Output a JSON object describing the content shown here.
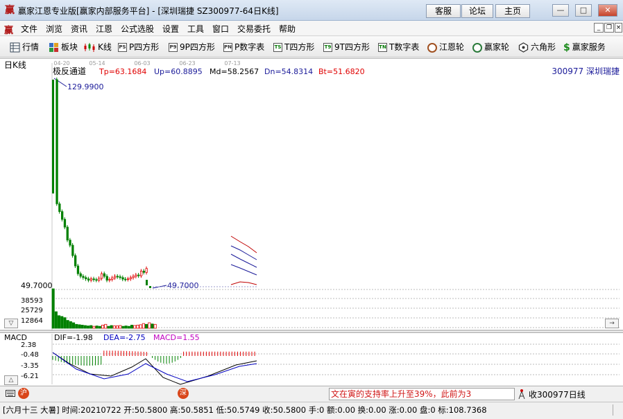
{
  "window": {
    "title": "赢家江恩专业版[赢家内部服务平台] - [深圳瑞捷  SZ300977-64日K线]",
    "links": [
      "客服",
      "论坛",
      "主页"
    ],
    "controls": [
      "—",
      "□",
      "✕"
    ]
  },
  "menu": {
    "items": [
      "文件",
      "浏览",
      "资讯",
      "江恩",
      "公式选股",
      "设置",
      "工具",
      "窗口",
      "交易委托",
      "帮助"
    ],
    "mdi_controls": [
      "_",
      "❐",
      "×"
    ]
  },
  "toolbar": {
    "items": [
      {
        "label": "行情",
        "icon": "grid-icon"
      },
      {
        "label": "板块",
        "icon": "blocks-icon"
      },
      {
        "label": "K线",
        "icon": "candlestick-icon"
      },
      {
        "label": "P四方形",
        "icon": "p-square-icon",
        "glyph": "PS"
      },
      {
        "label": "9P四方形",
        "icon": "9p-square-icon",
        "glyph": "P9"
      },
      {
        "label": "P数字表",
        "icon": "p-number-icon",
        "glyph": "PN"
      },
      {
        "label": "T四方形",
        "icon": "t-square-icon",
        "glyph": "TS"
      },
      {
        "label": "9T四方形",
        "icon": "9t-square-icon",
        "glyph": "T9"
      },
      {
        "label": "T数字表",
        "icon": "t-number-icon",
        "glyph": "TN"
      },
      {
        "label": "江恩轮",
        "icon": "gann-wheel-icon"
      },
      {
        "label": "赢家轮",
        "icon": "winner-wheel-icon"
      },
      {
        "label": "六角形",
        "icon": "hexagon-icon"
      },
      {
        "label": "赢家服务",
        "icon": "dollar-icon"
      }
    ]
  },
  "chart": {
    "period_label": "日K线",
    "indicator_name": "极反通道",
    "tp": "Tp=63.1684",
    "up": "Up=60.8895",
    "md": "Md=58.2567",
    "dn": "Dn=54.8314",
    "bt": "Bt=51.6820",
    "stock": "300977  深圳瑞捷",
    "date_ticks": [
      "04-20",
      "05-14",
      "06-03",
      "06-23",
      "07-13"
    ],
    "high_label": "129.9900",
    "low_label": "49.7000",
    "left_price": "49.7000",
    "volume_ticks": [
      "38593",
      "25729",
      "12864"
    ],
    "macd_title": "MACD",
    "dif": "DIF=-1.98",
    "dea": "DEA=-2.75",
    "macd": "MACD=1.55",
    "macd_ticks": [
      "2.38",
      "-0.48",
      "-3.35",
      "-6.21"
    ],
    "colors": {
      "up": "#e00000",
      "down": "#008000",
      "dif": "#000000",
      "dea": "#0000c0",
      "macd_text": "#c000c0"
    }
  },
  "chart_data": {
    "type": "candlestick",
    "title": "300977 深圳瑞捷 日K线",
    "x_ticks": [
      "04-20",
      "05-14",
      "06-03",
      "06-23",
      "07-13"
    ],
    "ylim": [
      49.7,
      129.99
    ],
    "series": [
      {
        "name": "close",
        "values": [
          129.99,
          82,
          79,
          76,
          73,
          68,
          66,
          62,
          58,
          55,
          54,
          53.5,
          53,
          52.5,
          53,
          52.7,
          52.5,
          53.2,
          55,
          54,
          52.5,
          52.8,
          53.4,
          54,
          53.8,
          53.5,
          52.9,
          52.8,
          53,
          53.5,
          54,
          54.5,
          54.2,
          56,
          55.5,
          57
        ]
      }
    ],
    "volume_ticks": [
      38593,
      25729,
      12864
    ],
    "macd": {
      "dif": -1.98,
      "dea": -2.75,
      "macd": 1.55,
      "ticks": [
        2.38,
        -0.48,
        -3.35,
        -6.21
      ]
    }
  },
  "status": {
    "ticker": "文在寅的支持率上升至39%，此前为3",
    "quote": "收300977日线",
    "info": "[六月十三 大暑] 时间:20210722 开:50.5800 高:50.5851 低:50.5749 收:50.5800 手:0 额:0.00 换:0.00 涨:0.00 盘:0 标:108.7368",
    "badge_sh": "沪",
    "badge_mid": "深"
  }
}
